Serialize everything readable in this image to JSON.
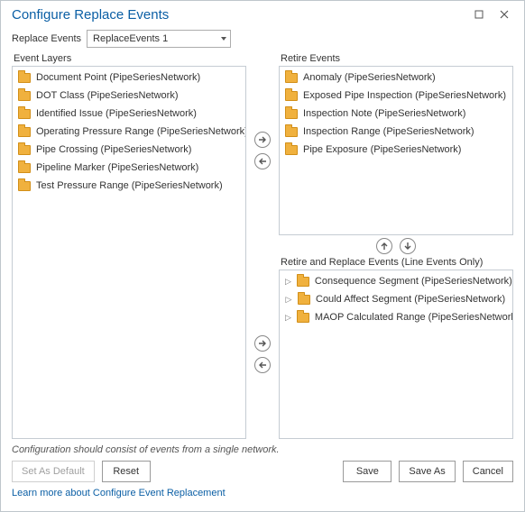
{
  "window": {
    "title": "Configure Replace Events"
  },
  "top": {
    "label": "Replace Events",
    "combo_value": "ReplaceEvents 1"
  },
  "panels": {
    "event_layers_label": "Event Layers",
    "retire_label": "Retire Events",
    "retire_replace_label": "Retire and Replace Events (Line Events Only)"
  },
  "event_layers": [
    "Document Point (PipeSeriesNetwork)",
    "DOT Class (PipeSeriesNetwork)",
    "Identified Issue (PipeSeriesNetwork)",
    "Operating Pressure Range (PipeSeriesNetwork)",
    "Pipe Crossing (PipeSeriesNetwork)",
    "Pipeline Marker (PipeSeriesNetwork)",
    "Test Pressure Range (PipeSeriesNetwork)"
  ],
  "retire_events": [
    "Anomaly (PipeSeriesNetwork)",
    "Exposed Pipe Inspection (PipeSeriesNetwork)",
    "Inspection Note (PipeSeriesNetwork)",
    "Inspection Range (PipeSeriesNetwork)",
    "Pipe Exposure (PipeSeriesNetwork)"
  ],
  "retire_replace_events": [
    "Consequence Segment (PipeSeriesNetwork)",
    "Could Affect Segment (PipeSeriesNetwork)",
    "MAOP Calculated Range (PipeSeriesNetwork)"
  ],
  "hint": "Configuration should consist of events from a single network.",
  "buttons": {
    "set_default": "Set As Default",
    "reset": "Reset",
    "save": "Save",
    "save_as": "Save As",
    "cancel": "Cancel"
  },
  "link": "Learn more about Configure Event Replacement"
}
